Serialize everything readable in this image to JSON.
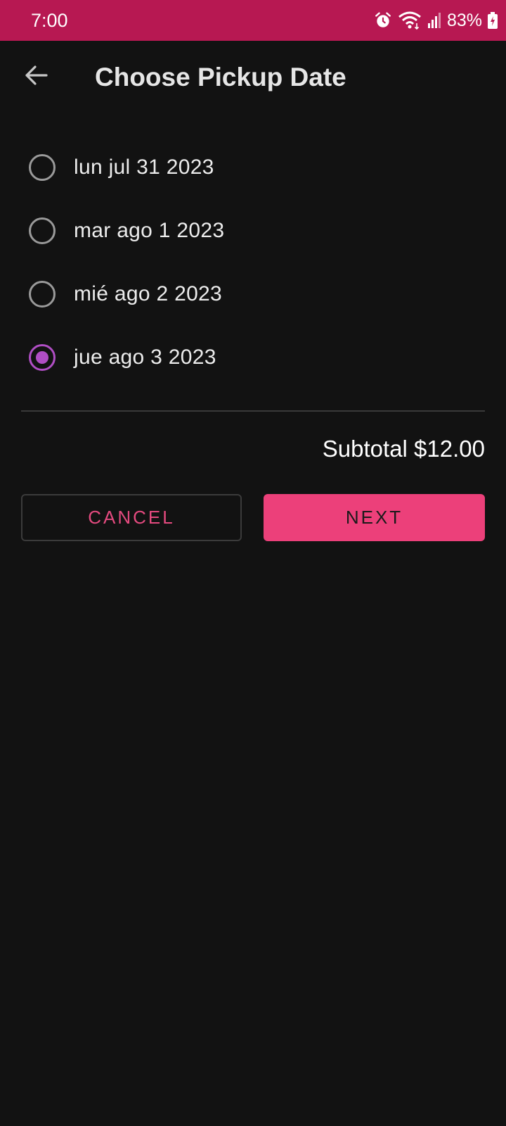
{
  "status_bar": {
    "time": "7:00",
    "battery": "83%",
    "icons": [
      "alarm-icon",
      "wifi-icon",
      "signal-icon",
      "battery-charging-icon"
    ],
    "background_color": "#b71852"
  },
  "app_bar": {
    "title": "Choose Pickup Date",
    "back_icon": "arrow-left-icon"
  },
  "dates": {
    "options": [
      {
        "label": "lun jul 31 2023",
        "selected": false
      },
      {
        "label": "mar ago 1 2023",
        "selected": false
      },
      {
        "label": "mié ago 2 2023",
        "selected": false
      },
      {
        "label": "jue ago 3 2023",
        "selected": true
      }
    ]
  },
  "summary": {
    "subtotal": "Subtotal $12.00"
  },
  "actions": {
    "cancel_label": "CANCEL",
    "next_label": "NEXT"
  },
  "colors": {
    "accent": "#ec407a",
    "radio_selected": "#b04ec4",
    "background": "#121212"
  }
}
